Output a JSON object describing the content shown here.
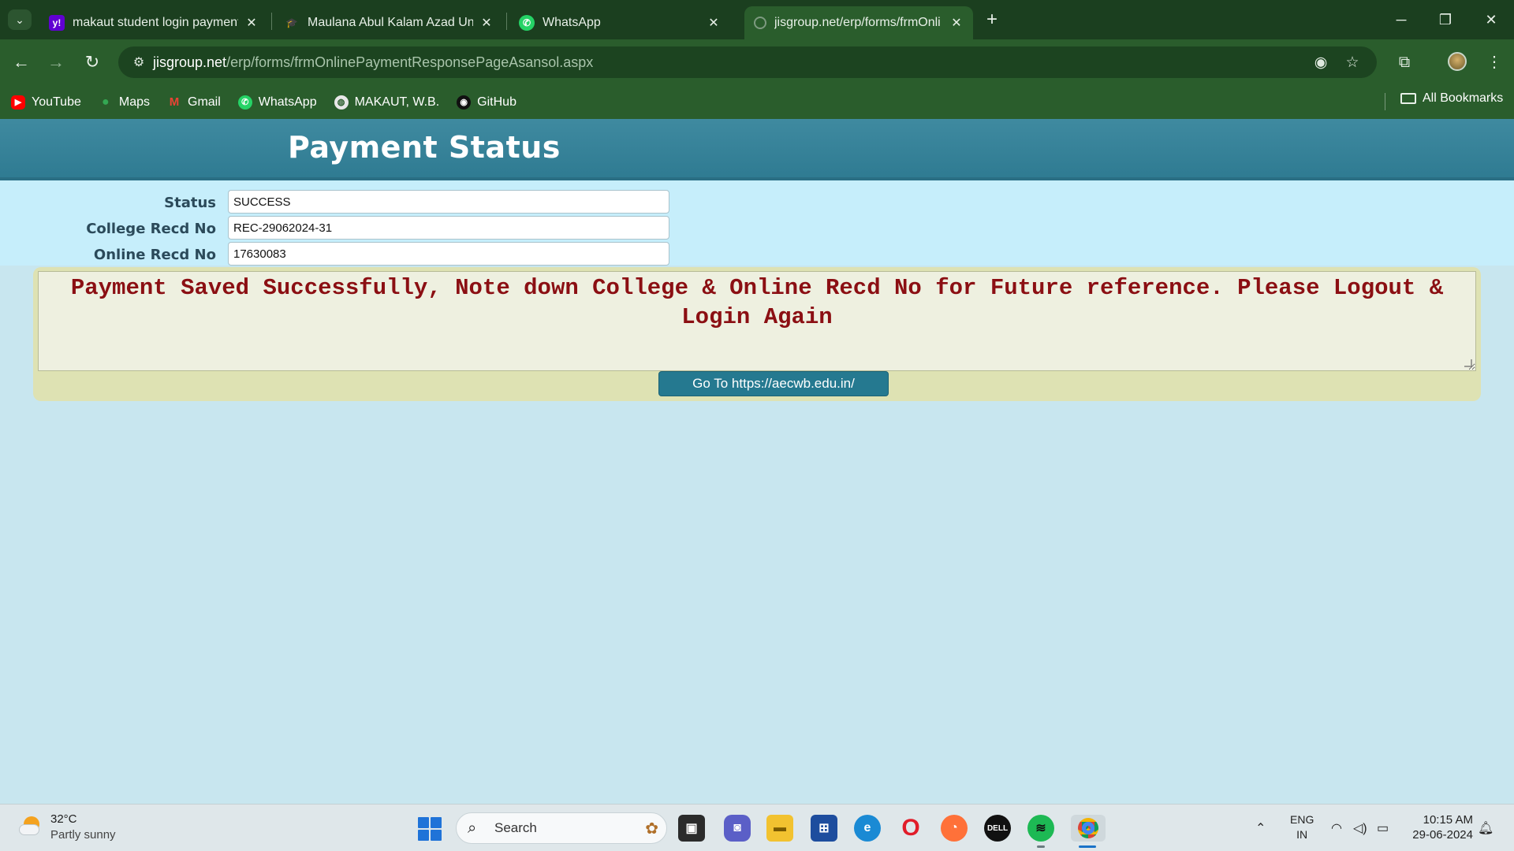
{
  "browser": {
    "tabs": [
      {
        "title": "makaut student login payment",
        "favicon": "yahoo-icon",
        "color": "#6001d2",
        "glyph": "y!"
      },
      {
        "title": "Maulana Abul Kalam Azad Univ",
        "favicon": "graduation-cap-icon",
        "color": "#3a4a3c",
        "glyph": "🎓"
      },
      {
        "title": "WhatsApp",
        "favicon": "whatsapp-icon",
        "color": "#25d366",
        "glyph": "✆"
      },
      {
        "title": "jisgroup.net/erp/forms/frmOnli",
        "favicon": "globe-icon",
        "color": "#7d9a80",
        "glyph": "◌"
      }
    ],
    "address": {
      "host": "jisgroup.net",
      "path": "/erp/forms/frmOnlinePaymentResponsePageAsansol.aspx"
    },
    "bookmarks": [
      {
        "label": "YouTube",
        "icon": "youtube-icon",
        "color": "#ff0000",
        "glyph": "▶"
      },
      {
        "label": "Maps",
        "icon": "maps-pin-icon",
        "color": "#34a853",
        "glyph": "●"
      },
      {
        "label": "Gmail",
        "icon": "gmail-icon",
        "color": "#ea4335",
        "glyph": "M"
      },
      {
        "label": "WhatsApp",
        "icon": "whatsapp-icon",
        "color": "#25d366",
        "glyph": "✆"
      },
      {
        "label": "MAKAUT, W.B.",
        "icon": "globe-icon",
        "color": "#e0e0e0",
        "glyph": "◍"
      },
      {
        "label": "GitHub",
        "icon": "github-icon",
        "color": "#111111",
        "glyph": "◉"
      }
    ],
    "all_bookmarks": "All Bookmarks"
  },
  "page": {
    "title": "Payment Status",
    "fields": [
      {
        "label": "Status",
        "value": "SUCCESS"
      },
      {
        "label": "College Recd No",
        "value": "REC-29062024-31"
      },
      {
        "label": "Online Recd No",
        "value": "17630083"
      }
    ],
    "message": "Payment Saved Successfully, Note down College & Online Recd No for Future reference. Please Logout & Login Again",
    "go_button": "Go To https://aecwb.edu.in/",
    "colors": {
      "header": "#3a87a0",
      "message_text": "#8b0f13",
      "button": "#257990"
    }
  },
  "taskbar": {
    "weather": {
      "temp": "32°C",
      "condition": "Partly sunny"
    },
    "search_label": "Search",
    "lang": {
      "line1": "ENG",
      "line2": "IN"
    },
    "clock": {
      "time": "10:15 AM",
      "date": "29-06-2024"
    }
  }
}
